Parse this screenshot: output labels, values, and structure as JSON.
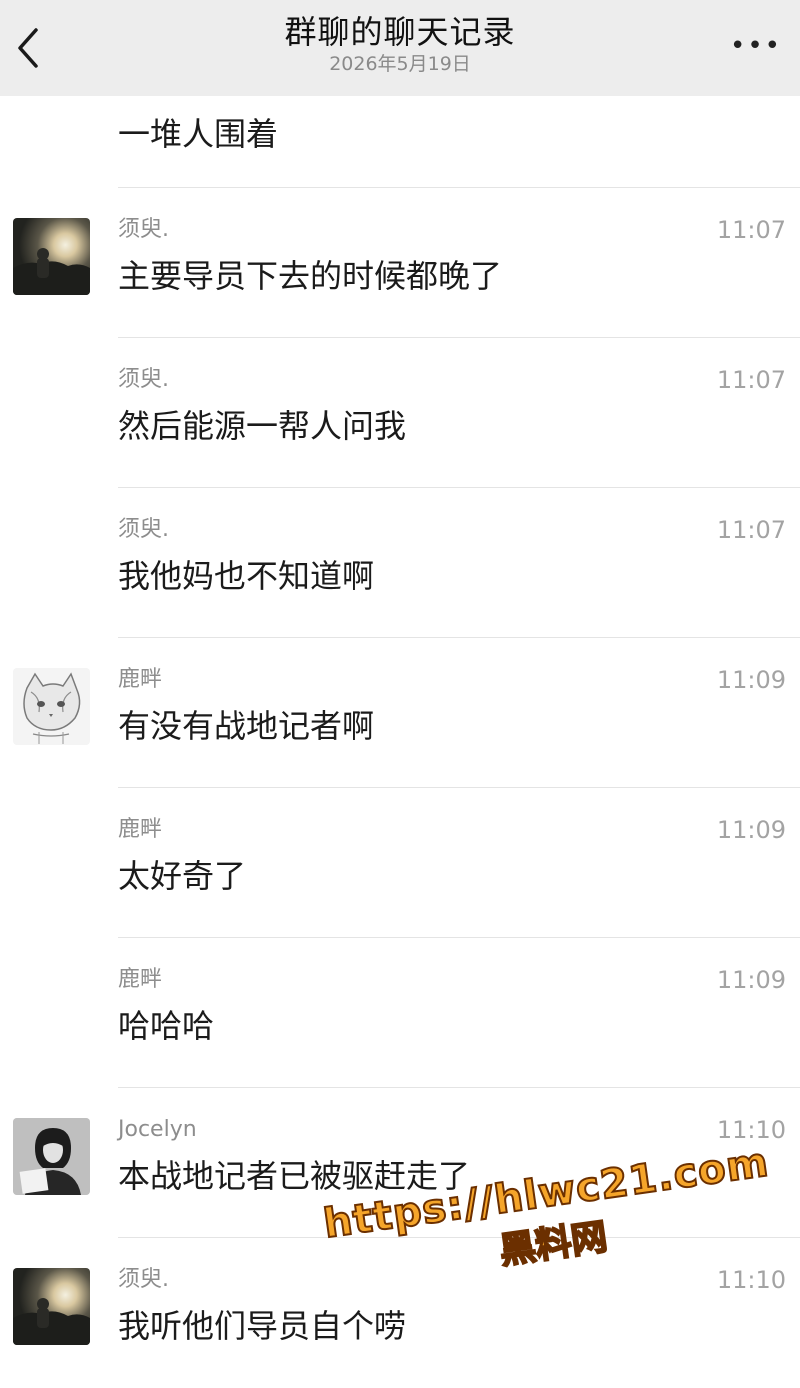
{
  "header": {
    "title": "群聊的聊天记录",
    "date": "2026年5月19日",
    "back_icon": "chevron-left-icon",
    "more_icon": "more-dots-icon",
    "more_label": "•••"
  },
  "first_message": {
    "text": "一堆人围着"
  },
  "messages": [
    {
      "sender": "须臾.",
      "time": "11:07",
      "text": "主要导员下去的时候都晚了",
      "avatar": "sunset-photo"
    },
    {
      "sender": "须臾.",
      "time": "11:07",
      "text": "然后能源一帮人问我",
      "avatar": ""
    },
    {
      "sender": "须臾.",
      "time": "11:07",
      "text": "我他妈也不知道啊",
      "avatar": ""
    },
    {
      "sender": "鹿畔",
      "time": "11:09",
      "text": "有没有战地记者啊",
      "avatar": "cat-sketch"
    },
    {
      "sender": "鹿畔",
      "time": "11:09",
      "text": "太好奇了",
      "avatar": ""
    },
    {
      "sender": "鹿畔",
      "time": "11:09",
      "text": "哈哈哈",
      "avatar": ""
    },
    {
      "sender": "Jocelyn",
      "time": "11:10",
      "text": "本战地记者已被驱赶走了",
      "avatar": "person-bw-photo"
    },
    {
      "sender": "须臾.",
      "time": "11:10",
      "text": "我听他们导员自个唠",
      "avatar": "sunset-photo"
    }
  ],
  "watermark": {
    "url": "https://hlwc21.com",
    "name": "黑料网"
  },
  "colors": {
    "header_bg": "#ededed",
    "separator": "#e4e4e4",
    "watermark_fill": "#f5a52a"
  }
}
